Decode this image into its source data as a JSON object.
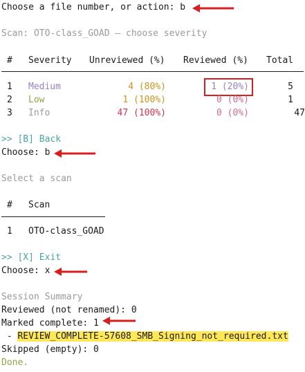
{
  "prompt1": {
    "prefix": "Choose a file number, or action:",
    "value": "b"
  },
  "scan_heading": "Scan: OTO-class_GOAD — choose severity",
  "severity_table": {
    "headers": [
      "#",
      "Severity",
      "Unreviewed (%)",
      "Reviewed (%)",
      "Total"
    ],
    "rows": [
      {
        "num": "1",
        "severity": "Medium",
        "unreviewed": "4 (80%)",
        "reviewed": "1 (20%)",
        "total": "5"
      },
      {
        "num": "2",
        "severity": "Low",
        "unreviewed": "1 (100%)",
        "reviewed": "0 (0%)",
        "total": "1"
      },
      {
        "num": "3",
        "severity": "Info",
        "unreviewed": "47 (100%)",
        "reviewed": "0 (0%)",
        "total": "47"
      }
    ]
  },
  "back_option": ">> [B] Back",
  "prompt2": {
    "prefix": "Choose:",
    "value": "b"
  },
  "select_scan": "Select a scan",
  "scan_table": {
    "headers": [
      "#",
      "Scan"
    ],
    "rows": [
      {
        "num": "1",
        "scan": "OTO-class_GOAD"
      }
    ]
  },
  "exit_option": ">> [X] Exit",
  "prompt3": {
    "prefix": "Choose:",
    "value": "x"
  },
  "summary": {
    "title": "Session Summary",
    "reviewed": "Reviewed (not renamed): 0",
    "marked": "Marked complete: 1",
    "file_prefix": " - ",
    "file": "REVIEW_COMPLETE-57608_SMB_Signing_not_required.txt",
    "skipped": "Skipped (empty): 0",
    "done": "Done."
  },
  "colors": {
    "annotation_red": "#d81e1e",
    "highlight": "#ffe857"
  }
}
